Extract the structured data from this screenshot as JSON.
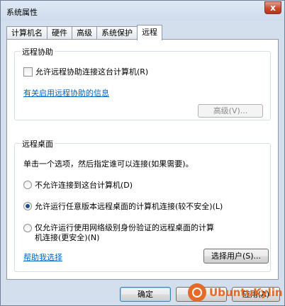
{
  "window": {
    "title": "系统属性",
    "close_glyph": "x"
  },
  "tabs": [
    {
      "label": "计算机名"
    },
    {
      "label": "硬件"
    },
    {
      "label": "高级"
    },
    {
      "label": "系统保护"
    },
    {
      "label": "远程"
    }
  ],
  "remote_assistance": {
    "title": "远程协助",
    "allow_checkbox_label": "允许远程协助连接这台计算机(R)",
    "allow_checked": false,
    "info_link": "有关启用远程协助的信息",
    "advanced_button": "高级(V)..."
  },
  "remote_desktop": {
    "title": "远程桌面",
    "instruction": "单击一个选项，然后指定谁可以连接(如果需要)。",
    "options": [
      {
        "label": "不允许连接到这台计算机(D)",
        "checked": false
      },
      {
        "label": "允许运行任意版本远程桌面的计算机连接(较不安全)(L)",
        "checked": true
      },
      {
        "label_line1": "仅允许运行使用网络级别身份验证的远程桌面的计算",
        "label_line2": "机连接(更安全)(N)",
        "checked": false
      }
    ],
    "help_link": "帮助我选择",
    "select_users_button": "选择用户(S)..."
  },
  "footer": {
    "ok_button": "确定",
    "cancel_button": "",
    "apply_button": "应用(A)"
  },
  "watermark": {
    "text": "UbuntuKylin"
  }
}
